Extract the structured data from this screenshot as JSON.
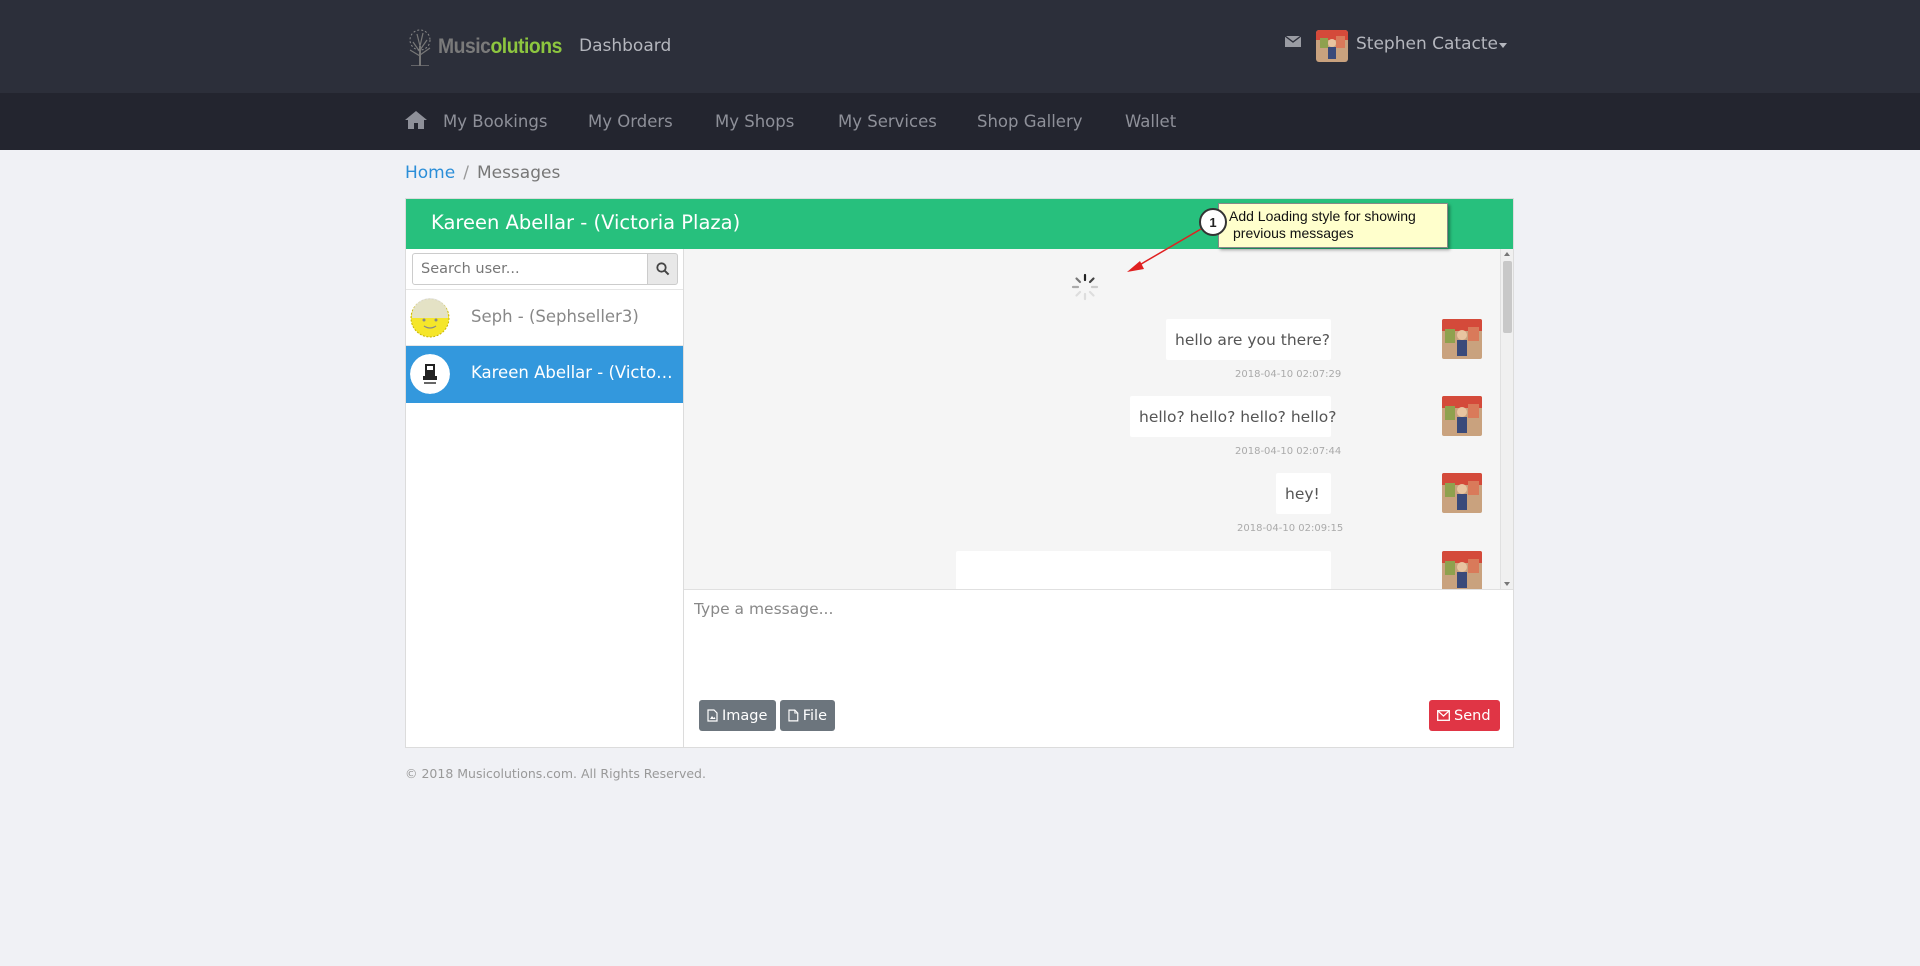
{
  "brand": {
    "logo_part1": "Music",
    "logo_part2": "olutions",
    "dashboard_link": "Dashboard"
  },
  "header": {
    "user_name": "Stephen Catacte"
  },
  "nav": {
    "items": [
      "My Bookings",
      "My Orders",
      "My Shops",
      "My Services",
      "Shop Gallery",
      "Wallet"
    ]
  },
  "breadcrumb": {
    "home": "Home",
    "separator": "/",
    "current": "Messages"
  },
  "chat": {
    "title": "Kareen Abellar - (Victoria Plaza)",
    "search_placeholder": "Search user...",
    "contacts": [
      {
        "name": "Seph - (Sephseller3)",
        "active": false
      },
      {
        "name": "Kareen Abellar - (Victoria Plaza)",
        "active": true
      }
    ],
    "messages": [
      {
        "text": "hello are you there?",
        "time": "2018-04-10 02:07:29"
      },
      {
        "text": "hello? hello? hello? hello?",
        "time": "2018-04-10 02:07:44"
      },
      {
        "text": "hey!",
        "time": "2018-04-10 02:09:15"
      }
    ],
    "compose_placeholder": "Type a message...",
    "buttons": {
      "image": "Image",
      "file": "File",
      "send": "Send"
    }
  },
  "annotation": {
    "number": "1",
    "line1": "Add Loading style for showing",
    "line2": "previous messages"
  },
  "footer": {
    "copyright": "© 2018 Musicolutions.com. All Rights Reserved."
  },
  "colors": {
    "header_bg": "#2c2f3a",
    "nav_bg": "#23252f",
    "chat_header": "#27c07d",
    "active_contact": "#3398dd",
    "send_button": "#e03545",
    "link": "#2b8ed8"
  }
}
